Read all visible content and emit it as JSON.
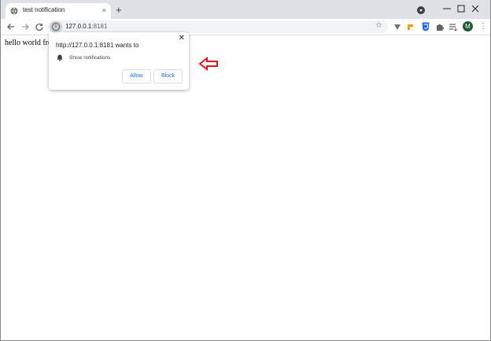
{
  "browser": {
    "tab_title": "test notification",
    "tab_close": "×",
    "new_tab": "+",
    "url_host": "127.0.0.1",
    "url_port": ":8181",
    "info_icon": "i",
    "avatar_letter": "M",
    "icons": [
      "globe-icon",
      "close-icon",
      "plus-icon",
      "profile-dropdown-icon",
      "minimize-icon",
      "maximize-icon",
      "window-close-icon",
      "back-icon",
      "forward-icon",
      "reload-icon",
      "info-icon",
      "star-icon",
      "extension-v-icon",
      "extension-orange-icon",
      "css3-icon",
      "puzzle-icon",
      "reading-list-icon",
      "avatar",
      "kebab-menu-icon"
    ]
  },
  "page": {
    "text": "hello world fror"
  },
  "permission_prompt": {
    "heading": "http://127.0.0.1:8181 wants to",
    "permission": "Show notifications",
    "allow_label": "Allow",
    "block_label": "Block",
    "close": "✕"
  },
  "annotation": {
    "arrow_color": "#e0141e"
  },
  "colors": {
    "accent": "#1a73e8",
    "tabstrip": "#dee1e6",
    "avatar": "#1e5a3a"
  }
}
